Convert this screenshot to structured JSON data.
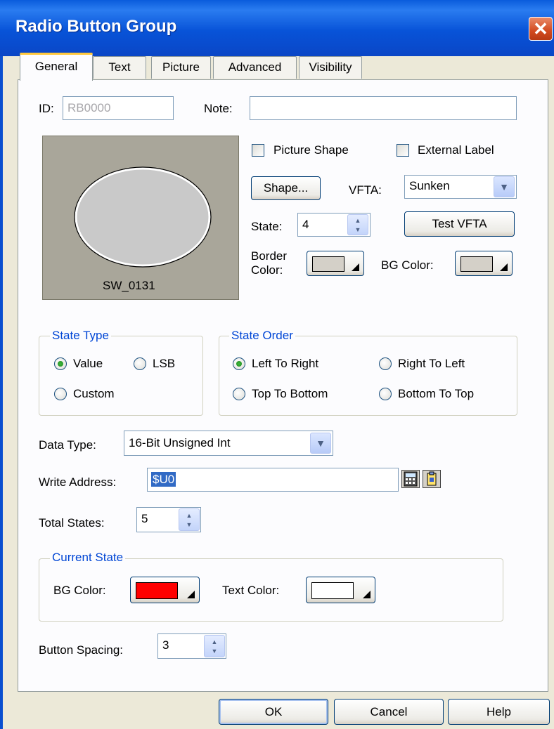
{
  "window": {
    "title": "Radio Button Group",
    "close_glyph": "✕"
  },
  "tabs": [
    {
      "label": "General",
      "active": true
    },
    {
      "label": "Text"
    },
    {
      "label": "Picture"
    },
    {
      "label": "Advanced"
    },
    {
      "label": "Visibility"
    }
  ],
  "general": {
    "id_label": "ID:",
    "id_value": "RB0000",
    "note_label": "Note:",
    "note_value": "",
    "preview_caption": "SW_0131",
    "picture_shape_label": "Picture Shape",
    "picture_shape_checked": false,
    "external_label_label": "External Label",
    "external_label_checked": false,
    "shape_button": "Shape...",
    "vfta_label": "VFTA:",
    "vfta_value": "Sunken",
    "state_label": "State:",
    "state_value": "4",
    "test_vfta_button": "Test VFTA",
    "border_color_label_1": "Border",
    "border_color_label_2": "Color:",
    "border_color": "#d4d0c8",
    "bg_color_label": "BG Color:",
    "bg_color": "#d4d0c8"
  },
  "state_type": {
    "legend": "State Type",
    "options": [
      {
        "label": "Value",
        "selected": true
      },
      {
        "label": "LSB",
        "selected": false
      },
      {
        "label": "Custom",
        "selected": false
      }
    ]
  },
  "state_order": {
    "legend": "State Order",
    "options": [
      {
        "label": "Left To Right",
        "selected": true
      },
      {
        "label": "Right To Left",
        "selected": false
      },
      {
        "label": "Top To Bottom",
        "selected": false
      },
      {
        "label": "Bottom To Top",
        "selected": false
      }
    ]
  },
  "data_type": {
    "label": "Data Type:",
    "value": "16-Bit Unsigned Int"
  },
  "write_address": {
    "label": "Write Address:",
    "value": "$U0"
  },
  "total_states": {
    "label": "Total States:",
    "value": "5"
  },
  "current_state": {
    "legend": "Current State",
    "bg_color_label": "BG Color:",
    "bg_color": "#ff0000",
    "text_color_label": "Text Color:",
    "text_color": "#ffffff"
  },
  "button_spacing": {
    "label": "Button Spacing:",
    "value": "3"
  },
  "buttons": {
    "ok": "OK",
    "cancel": "Cancel",
    "help": "Help"
  },
  "colors": {
    "title_bar": "#0a5cdc",
    "accent_blue": "#0046d5",
    "panel_bg": "#fcfcfe",
    "window_bg": "#ece9d8"
  }
}
